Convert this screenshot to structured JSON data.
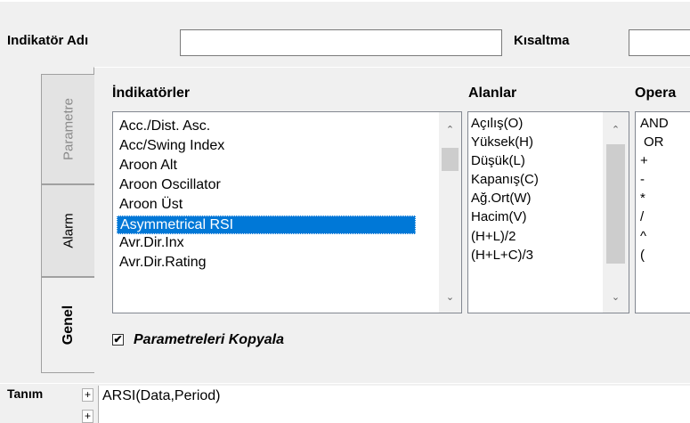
{
  "header": {
    "name_label": "Indikatör Adı",
    "name_value": "",
    "short_label": "Kısaltma",
    "short_value": ""
  },
  "tabs": [
    {
      "label": "Parametre",
      "active": false
    },
    {
      "label": "Alarm",
      "active": false
    },
    {
      "label": "Genel",
      "active": true
    }
  ],
  "indicators": {
    "label": "İndikatörler",
    "items": [
      "Acc./Dist. Asc.",
      "Acc/Swing Index",
      "Aroon Alt",
      "Aroon Oscillator",
      "Aroon Üst",
      "Asymmetrical RSI",
      "Avr.Dir.Inx",
      "Avr.Dir.Rating"
    ],
    "selected": "Asymmetrical RSI"
  },
  "fields": {
    "label": "Alanlar",
    "items": [
      "Açılış(O)",
      "Yüksek(H)",
      "Düşük(L)",
      "Kapanış(C)",
      "Ağ.Ort(W)",
      "Hacim(V)",
      "(H+L)/2",
      "(H+L+C)/3"
    ]
  },
  "operators": {
    "label": "Opera",
    "items": [
      "AND",
      "OR",
      "+",
      "-",
      "*",
      "/",
      "^",
      "("
    ]
  },
  "copy_params": {
    "label": "Parametreleri Kopyala",
    "checked": true,
    "mark": "✔"
  },
  "definition": {
    "label": "Tanım",
    "expand1": "+",
    "expand2": "+",
    "value": "ARSI(Data,Period)"
  },
  "colors": {
    "selection": "#0078d7",
    "window_bg": "#f0f0f0"
  }
}
